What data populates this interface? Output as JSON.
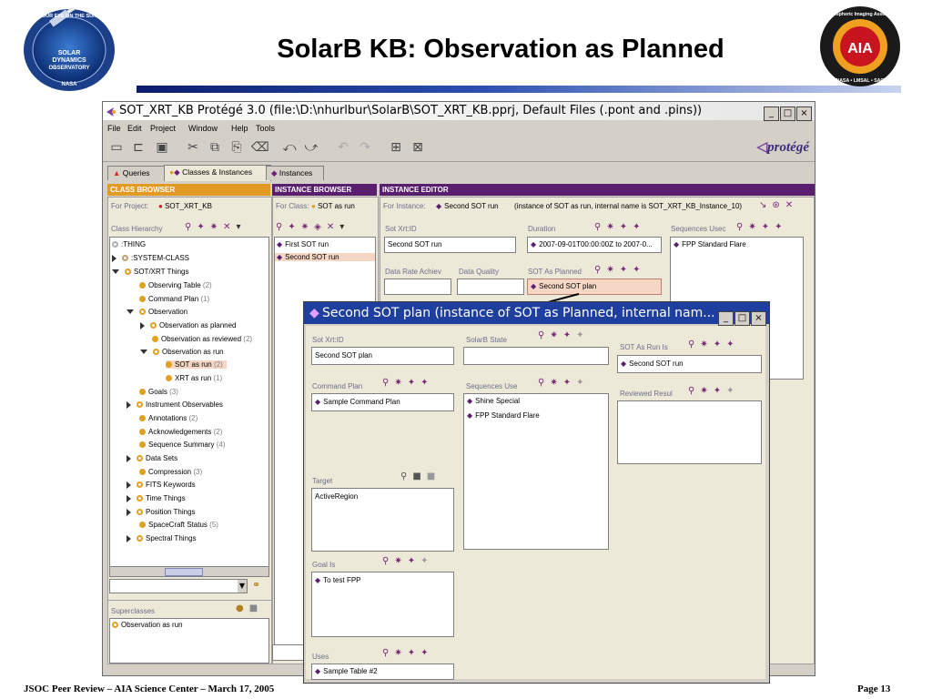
{
  "slide": {
    "title": "SolarB KB: Observation as Planned",
    "footer_left": "JSOC Peer Review – AIA Science Center – March 17, 2005",
    "footer_right": "Page 13",
    "logo_left": {
      "top_text": "OUR EYE ON THE SUN",
      "lines": [
        "SOLAR",
        "DYNAMICS",
        "OBSERVATORY"
      ],
      "bottom_text": "NASA"
    },
    "logo_right": {
      "top_text": "Atmospheric Imaging Assembly",
      "center": "AIA",
      "bottom_text": "NASA • LMSAL • SAO"
    }
  },
  "window": {
    "title": "SOT_XRT_KB  Protégé 3.0    (file:\\D:\\nhurlbur\\SolarB\\SOT_XRT_KB.pprj, Default Files (.pont and .pins))",
    "menu": [
      "File",
      "Edit",
      "Project",
      "Window",
      "Help",
      "Tools"
    ],
    "brand": "protégé",
    "tabs": [
      "Queries",
      "Classes & Instances",
      "Instances"
    ]
  },
  "class_browser": {
    "header": "CLASS BROWSER",
    "project_label": "For Project:",
    "project": "SOT_XRT_KB",
    "hierarchy_label": "Class Hierarchy",
    "tree": [
      {
        "label": ":THING",
        "count": ""
      },
      {
        "label": ":SYSTEM-CLASS",
        "count": ""
      },
      {
        "label": "SOT/XRT Things",
        "count": ""
      },
      {
        "label": "Observing Table",
        "count": "(2)"
      },
      {
        "label": "Command Plan",
        "count": "(1)"
      },
      {
        "label": "Observation",
        "count": ""
      },
      {
        "label": "Observation as planned",
        "count": ""
      },
      {
        "label": "Observation as reviewed",
        "count": "(2)"
      },
      {
        "label": "Observation as run",
        "count": ""
      },
      {
        "label": "SOT as run",
        "count": "(2)"
      },
      {
        "label": "XRT as run",
        "count": "(1)"
      },
      {
        "label": "Goals",
        "count": "(3)"
      },
      {
        "label": "Instrument Observables",
        "count": ""
      },
      {
        "label": "Annotations",
        "count": "(2)"
      },
      {
        "label": "Acknowledgements",
        "count": "(2)"
      },
      {
        "label": "Sequence Summary",
        "count": "(4)"
      },
      {
        "label": "Data Sets",
        "count": ""
      },
      {
        "label": "Compression",
        "count": "(3)"
      },
      {
        "label": "FITS Keywords",
        "count": ""
      },
      {
        "label": "Time Things",
        "count": ""
      },
      {
        "label": "Position Things",
        "count": ""
      },
      {
        "label": "SpaceCraft Status",
        "count": "(5)"
      },
      {
        "label": "Spectral Things",
        "count": ""
      }
    ],
    "superclasses_label": "Superclasses",
    "superclass": "Observation as run"
  },
  "instance_browser": {
    "header": "INSTANCE BROWSER",
    "class_label": "For Class:",
    "class": "SOT as run",
    "instances": [
      "First SOT run",
      "Second SOT run"
    ]
  },
  "instance_editor": {
    "header": "INSTANCE EDITOR",
    "instance_label": "For Instance:",
    "instance": "Second SOT run",
    "instance_note": "(instance of SOT as run, internal name is SOT_XRT_KB_Instance_10)",
    "fields": {
      "sot_id_label": "Sot Xrt:ID",
      "sot_id": "Second SOT run",
      "duration_label": "Duration",
      "duration": "2007-09-01T00:00:00Z to 2007-0...",
      "sequences_label": "Sequences Usec",
      "sequence": "FPP Standard Flare",
      "data_rate_label": "Data Rate Achiev",
      "data_quality_label": "Data Quality",
      "planned_label": "SOT As Planned",
      "planned": "Second SOT plan"
    }
  },
  "popup": {
    "title": "Second SOT plan   (instance of SOT as Planned, internal nam...",
    "sot_id_label": "Sot Xrt:ID",
    "sot_id": "Second SOT plan",
    "solarb_state_label": "SolarB State",
    "sot_as_run_label": "SOT As Run Is",
    "sot_as_run": "Second SOT run",
    "command_plan_label": "Command Plan",
    "command_plan": "Sample Command Plan",
    "sequences_label": "Sequences Use",
    "sequences": [
      "Shine Special",
      "FPP Standard Flare"
    ],
    "reviewed_label": "Reviewed Resul",
    "target_label": "Target",
    "target": "ActiveRegion",
    "goal_label": "Goal Is",
    "goal": "To test FPP",
    "uses_label": "Uses",
    "uses": "Sample Table #2"
  }
}
